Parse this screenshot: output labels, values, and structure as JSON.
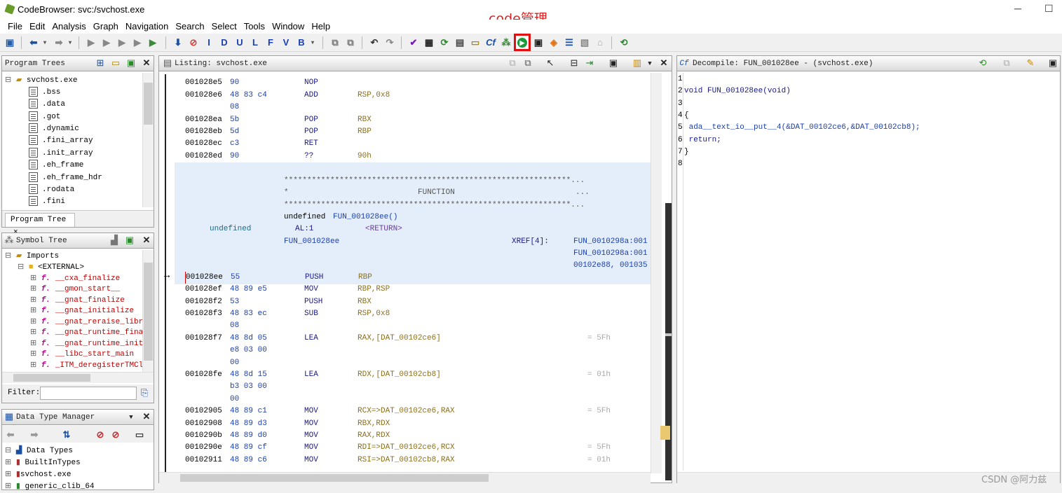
{
  "window": {
    "title": "CodeBrowser: svc:/svchost.exe",
    "minimize": "─",
    "maximize": "☐"
  },
  "annotation": "code管理",
  "menu": [
    "File",
    "Edit",
    "Analysis",
    "Graph",
    "Navigation",
    "Search",
    "Select",
    "Tools",
    "Window",
    "Help"
  ],
  "program_trees": {
    "title": "Program Trees",
    "root": "svchost.exe",
    "items": [
      ".bss",
      ".data",
      ".got",
      ".dynamic",
      ".fini_array",
      ".init_array",
      ".eh_frame",
      ".eh_frame_hdr",
      ".rodata",
      ".fini"
    ],
    "tab": "Program Tree"
  },
  "symbol_tree": {
    "title": "Symbol Tree",
    "imports": "Imports",
    "external": "<EXTERNAL>",
    "functions": [
      "__cxa_finalize",
      "__gmon_start__",
      "__gnat_finalize",
      "__gnat_initialize",
      "__gnat_reraise_librar",
      "__gnat_runtime_finali",
      "__gnat_runtime_initia",
      "__libc_start_main",
      "_ITM_deregisterTMClon"
    ],
    "filter_label": "Filter:"
  },
  "data_type_manager": {
    "title": "Data Type Manager",
    "items": [
      "Data Types",
      "BuiltInTypes",
      "svchost.exe",
      "generic_clib_64"
    ]
  },
  "listing": {
    "title": "Listing:  svchost.exe",
    "rows_top": [
      {
        "addr": "001028e5",
        "bytes": "90",
        "mn": "NOP",
        "op": ""
      },
      {
        "addr": "001028e6",
        "bytes": "48 83 c4",
        "mn": "ADD",
        "op": "RSP,0x8"
      },
      {
        "addr": "",
        "bytes": "08",
        "mn": "",
        "op": ""
      },
      {
        "addr": "001028ea",
        "bytes": "5b",
        "mn": "POP",
        "op": "RBX"
      },
      {
        "addr": "001028eb",
        "bytes": "5d",
        "mn": "POP",
        "op": "RBP"
      },
      {
        "addr": "001028ec",
        "bytes": "c3",
        "mn": "RET",
        "op": ""
      },
      {
        "addr": "001028ed",
        "bytes": "90",
        "mn": "??",
        "op": "90h"
      }
    ],
    "banner1": "**************************************************************...",
    "banner_mid_star": "*",
    "banner_function": "FUNCTION",
    "banner_mid_dots": "...",
    "banner2": "**************************************************************...",
    "signature_type": "undefined",
    "signature_name": "FUN_001028ee()",
    "ret_type": "undefined",
    "ret_reg": "AL:1",
    "ret_name": "<RETURN>",
    "label": "FUN_001028ee",
    "xref": "XREF[4]:",
    "xref_vals": [
      "FUN_0010298a:001",
      "FUN_0010298a:001",
      "00102e88, 001035"
    ],
    "rows_bottom": [
      {
        "addr": "001028ee",
        "bytes": "55",
        "mn": "PUSH",
        "op": "RBP",
        "cm": ""
      },
      {
        "addr": "001028ef",
        "bytes": "48 89 e5",
        "mn": "MOV",
        "op": "RBP,RSP",
        "cm": ""
      },
      {
        "addr": "001028f2",
        "bytes": "53",
        "mn": "PUSH",
        "op": "RBX",
        "cm": ""
      },
      {
        "addr": "001028f3",
        "bytes": "48 83 ec",
        "mn": "SUB",
        "op": "RSP,0x8",
        "cm": ""
      },
      {
        "addr": "",
        "bytes": "08",
        "mn": "",
        "op": "",
        "cm": ""
      },
      {
        "addr": "001028f7",
        "bytes": "48 8d 05",
        "mn": "LEA",
        "op": "RAX,[DAT_00102ce6]",
        "cm": "= 5Fh"
      },
      {
        "addr": "",
        "bytes": "e8 03 00",
        "mn": "",
        "op": "",
        "cm": ""
      },
      {
        "addr": "",
        "bytes": "00",
        "mn": "",
        "op": "",
        "cm": ""
      },
      {
        "addr": "001028fe",
        "bytes": "48 8d 15",
        "mn": "LEA",
        "op": "RDX,[DAT_00102cb8]",
        "cm": "= 01h"
      },
      {
        "addr": "",
        "bytes": "b3 03 00",
        "mn": "",
        "op": "",
        "cm": ""
      },
      {
        "addr": "",
        "bytes": "00",
        "mn": "",
        "op": "",
        "cm": ""
      },
      {
        "addr": "00102905",
        "bytes": "48 89 c1",
        "mn": "MOV",
        "op": "RCX=>DAT_00102ce6,RAX",
        "cm": "= 5Fh"
      },
      {
        "addr": "00102908",
        "bytes": "48 89 d3",
        "mn": "MOV",
        "op": "RBX,RDX",
        "cm": ""
      },
      {
        "addr": "0010290b",
        "bytes": "48 89 d0",
        "mn": "MOV",
        "op": "RAX,RDX",
        "cm": ""
      },
      {
        "addr": "0010290e",
        "bytes": "48 89 cf",
        "mn": "MOV",
        "op": "RDI=>DAT_00102ce6,RCX",
        "cm": "= 5Fh"
      },
      {
        "addr": "00102911",
        "bytes": "48 89 c6",
        "mn": "MOV",
        "op": "RSI=>DAT_00102cb8,RAX",
        "cm": "= 01h"
      }
    ]
  },
  "decompile": {
    "title": "Decompile: FUN_001028ee -  (svchost.exe)",
    "lines": [
      {
        "n": "1",
        "text": ""
      },
      {
        "n": "2",
        "text": "void FUN_001028ee(void)"
      },
      {
        "n": "3",
        "text": ""
      },
      {
        "n": "4",
        "text": "{"
      },
      {
        "n": "5",
        "text": "  ada__text_io__put__4(&DAT_00102ce6,&DAT_00102cb8);"
      },
      {
        "n": "6",
        "text": "  return;"
      },
      {
        "n": "7",
        "text": "}"
      },
      {
        "n": "8",
        "text": ""
      }
    ]
  },
  "watermark": "CSDN @阿力兹",
  "colors": {
    "accent_red": "#e01010",
    "selection": "#e4eefa"
  }
}
